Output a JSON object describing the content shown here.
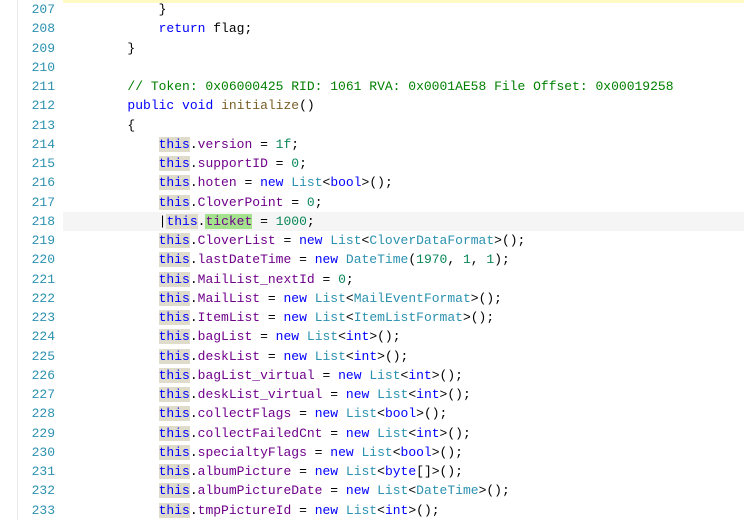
{
  "lines": [
    {
      "n": 207,
      "cls": "hl-yellow-top",
      "tokens": [
        [
          "            ",
          "ws"
        ],
        [
          "}",
          "punc"
        ]
      ]
    },
    {
      "n": 208,
      "tokens": [
        [
          "            ",
          "ws"
        ],
        [
          "return",
          "keyword"
        ],
        [
          " ",
          "ws"
        ],
        [
          "flag",
          "ident"
        ],
        [
          ";",
          "punc"
        ]
      ]
    },
    {
      "n": 209,
      "tokens": [
        [
          "        ",
          "ws"
        ],
        [
          "}",
          "punc"
        ]
      ]
    },
    {
      "n": 210,
      "tokens": [
        [
          "",
          "ws"
        ]
      ]
    },
    {
      "n": 211,
      "tokens": [
        [
          "        ",
          "ws"
        ],
        [
          "// Token: 0x06000425 RID: 1061 RVA: 0x0001AE58 File Offset: 0x00019258",
          "comment"
        ]
      ]
    },
    {
      "n": 212,
      "tokens": [
        [
          "        ",
          "ws"
        ],
        [
          "public",
          "keyword"
        ],
        [
          " ",
          "ws"
        ],
        [
          "void",
          "keyword"
        ],
        [
          " ",
          "ws"
        ],
        [
          "initialize",
          "method"
        ],
        [
          "()",
          "punc"
        ]
      ]
    },
    {
      "n": 213,
      "tokens": [
        [
          "        ",
          "ws"
        ],
        [
          "{",
          "punc"
        ]
      ]
    },
    {
      "n": 214,
      "tokens": [
        [
          "            ",
          "ws"
        ],
        [
          "this",
          "this"
        ],
        [
          ".",
          "punc"
        ],
        [
          "version",
          "prop"
        ],
        [
          " = ",
          "op"
        ],
        [
          "1f",
          "number"
        ],
        [
          ";",
          "punc"
        ]
      ]
    },
    {
      "n": 215,
      "tokens": [
        [
          "            ",
          "ws"
        ],
        [
          "this",
          "this"
        ],
        [
          ".",
          "punc"
        ],
        [
          "supportID",
          "prop"
        ],
        [
          " = ",
          "op"
        ],
        [
          "0",
          "number"
        ],
        [
          ";",
          "punc"
        ]
      ]
    },
    {
      "n": 216,
      "tokens": [
        [
          "            ",
          "ws"
        ],
        [
          "this",
          "this"
        ],
        [
          ".",
          "punc"
        ],
        [
          "hoten",
          "prop"
        ],
        [
          " = ",
          "op"
        ],
        [
          "new",
          "keyword"
        ],
        [
          " ",
          "ws"
        ],
        [
          "List",
          "type"
        ],
        [
          "<",
          "punc"
        ],
        [
          "bool",
          "keyword"
        ],
        [
          ">();",
          "punc"
        ]
      ]
    },
    {
      "n": 217,
      "tokens": [
        [
          "            ",
          "ws"
        ],
        [
          "this",
          "this"
        ],
        [
          ".",
          "punc"
        ],
        [
          "CloverPoint",
          "prop"
        ],
        [
          " = ",
          "op"
        ],
        [
          "0",
          "number"
        ],
        [
          ";",
          "punc"
        ]
      ]
    },
    {
      "n": 218,
      "cls": "current",
      "tokens": [
        [
          "            ",
          "ws"
        ],
        [
          "|",
          "caret"
        ],
        [
          "this",
          "this"
        ],
        [
          ".",
          "punc"
        ],
        [
          "ticket",
          "ticket"
        ],
        [
          " = ",
          "op"
        ],
        [
          "1000",
          "number"
        ],
        [
          ";",
          "punc"
        ]
      ]
    },
    {
      "n": 219,
      "tokens": [
        [
          "            ",
          "ws"
        ],
        [
          "this",
          "this"
        ],
        [
          ".",
          "punc"
        ],
        [
          "CloverList",
          "prop"
        ],
        [
          " = ",
          "op"
        ],
        [
          "new",
          "keyword"
        ],
        [
          " ",
          "ws"
        ],
        [
          "List",
          "type"
        ],
        [
          "<",
          "punc"
        ],
        [
          "CloverDataFormat",
          "type"
        ],
        [
          ">();",
          "punc"
        ]
      ]
    },
    {
      "n": 220,
      "tokens": [
        [
          "            ",
          "ws"
        ],
        [
          "this",
          "this"
        ],
        [
          ".",
          "punc"
        ],
        [
          "lastDateTime",
          "prop"
        ],
        [
          " = ",
          "op"
        ],
        [
          "new",
          "keyword"
        ],
        [
          " ",
          "ws"
        ],
        [
          "DateTime",
          "type"
        ],
        [
          "(",
          "punc"
        ],
        [
          "1970",
          "number"
        ],
        [
          ", ",
          "punc"
        ],
        [
          "1",
          "number"
        ],
        [
          ", ",
          "punc"
        ],
        [
          "1",
          "number"
        ],
        [
          ");",
          "punc"
        ]
      ]
    },
    {
      "n": 221,
      "tokens": [
        [
          "            ",
          "ws"
        ],
        [
          "this",
          "this"
        ],
        [
          ".",
          "punc"
        ],
        [
          "MailList_nextId",
          "prop"
        ],
        [
          " = ",
          "op"
        ],
        [
          "0",
          "number"
        ],
        [
          ";",
          "punc"
        ]
      ]
    },
    {
      "n": 222,
      "tokens": [
        [
          "            ",
          "ws"
        ],
        [
          "this",
          "this"
        ],
        [
          ".",
          "punc"
        ],
        [
          "MailList",
          "prop"
        ],
        [
          " = ",
          "op"
        ],
        [
          "new",
          "keyword"
        ],
        [
          " ",
          "ws"
        ],
        [
          "List",
          "type"
        ],
        [
          "<",
          "punc"
        ],
        [
          "MailEventFormat",
          "type"
        ],
        [
          ">();",
          "punc"
        ]
      ]
    },
    {
      "n": 223,
      "tokens": [
        [
          "            ",
          "ws"
        ],
        [
          "this",
          "this"
        ],
        [
          ".",
          "punc"
        ],
        [
          "ItemList",
          "prop"
        ],
        [
          " = ",
          "op"
        ],
        [
          "new",
          "keyword"
        ],
        [
          " ",
          "ws"
        ],
        [
          "List",
          "type"
        ],
        [
          "<",
          "punc"
        ],
        [
          "ItemListFormat",
          "type"
        ],
        [
          ">();",
          "punc"
        ]
      ]
    },
    {
      "n": 224,
      "tokens": [
        [
          "            ",
          "ws"
        ],
        [
          "this",
          "this"
        ],
        [
          ".",
          "punc"
        ],
        [
          "bagList",
          "prop"
        ],
        [
          " = ",
          "op"
        ],
        [
          "new",
          "keyword"
        ],
        [
          " ",
          "ws"
        ],
        [
          "List",
          "type"
        ],
        [
          "<",
          "punc"
        ],
        [
          "int",
          "keyword"
        ],
        [
          ">();",
          "punc"
        ]
      ]
    },
    {
      "n": 225,
      "tokens": [
        [
          "            ",
          "ws"
        ],
        [
          "this",
          "this"
        ],
        [
          ".",
          "punc"
        ],
        [
          "deskList",
          "prop"
        ],
        [
          " = ",
          "op"
        ],
        [
          "new",
          "keyword"
        ],
        [
          " ",
          "ws"
        ],
        [
          "List",
          "type"
        ],
        [
          "<",
          "punc"
        ],
        [
          "int",
          "keyword"
        ],
        [
          ">();",
          "punc"
        ]
      ]
    },
    {
      "n": 226,
      "tokens": [
        [
          "            ",
          "ws"
        ],
        [
          "this",
          "this"
        ],
        [
          ".",
          "punc"
        ],
        [
          "bagList_virtual",
          "prop"
        ],
        [
          " = ",
          "op"
        ],
        [
          "new",
          "keyword"
        ],
        [
          " ",
          "ws"
        ],
        [
          "List",
          "type"
        ],
        [
          "<",
          "punc"
        ],
        [
          "int",
          "keyword"
        ],
        [
          ">();",
          "punc"
        ]
      ]
    },
    {
      "n": 227,
      "tokens": [
        [
          "            ",
          "ws"
        ],
        [
          "this",
          "this"
        ],
        [
          ".",
          "punc"
        ],
        [
          "deskList_virtual",
          "prop"
        ],
        [
          " = ",
          "op"
        ],
        [
          "new",
          "keyword"
        ],
        [
          " ",
          "ws"
        ],
        [
          "List",
          "type"
        ],
        [
          "<",
          "punc"
        ],
        [
          "int",
          "keyword"
        ],
        [
          ">();",
          "punc"
        ]
      ]
    },
    {
      "n": 228,
      "tokens": [
        [
          "            ",
          "ws"
        ],
        [
          "this",
          "this"
        ],
        [
          ".",
          "punc"
        ],
        [
          "collectFlags",
          "prop"
        ],
        [
          " = ",
          "op"
        ],
        [
          "new",
          "keyword"
        ],
        [
          " ",
          "ws"
        ],
        [
          "List",
          "type"
        ],
        [
          "<",
          "punc"
        ],
        [
          "bool",
          "keyword"
        ],
        [
          ">();",
          "punc"
        ]
      ]
    },
    {
      "n": 229,
      "tokens": [
        [
          "            ",
          "ws"
        ],
        [
          "this",
          "this"
        ],
        [
          ".",
          "punc"
        ],
        [
          "collectFailedCnt",
          "prop"
        ],
        [
          " = ",
          "op"
        ],
        [
          "new",
          "keyword"
        ],
        [
          " ",
          "ws"
        ],
        [
          "List",
          "type"
        ],
        [
          "<",
          "punc"
        ],
        [
          "int",
          "keyword"
        ],
        [
          ">();",
          "punc"
        ]
      ]
    },
    {
      "n": 230,
      "tokens": [
        [
          "            ",
          "ws"
        ],
        [
          "this",
          "this"
        ],
        [
          ".",
          "punc"
        ],
        [
          "specialtyFlags",
          "prop"
        ],
        [
          " = ",
          "op"
        ],
        [
          "new",
          "keyword"
        ],
        [
          " ",
          "ws"
        ],
        [
          "List",
          "type"
        ],
        [
          "<",
          "punc"
        ],
        [
          "bool",
          "keyword"
        ],
        [
          ">();",
          "punc"
        ]
      ]
    },
    {
      "n": 231,
      "tokens": [
        [
          "            ",
          "ws"
        ],
        [
          "this",
          "this"
        ],
        [
          ".",
          "punc"
        ],
        [
          "albumPicture",
          "prop"
        ],
        [
          " = ",
          "op"
        ],
        [
          "new",
          "keyword"
        ],
        [
          " ",
          "ws"
        ],
        [
          "List",
          "type"
        ],
        [
          "<",
          "punc"
        ],
        [
          "byte",
          "keyword"
        ],
        [
          "[]>();",
          "punc"
        ]
      ]
    },
    {
      "n": 232,
      "tokens": [
        [
          "            ",
          "ws"
        ],
        [
          "this",
          "this"
        ],
        [
          ".",
          "punc"
        ],
        [
          "albumPictureDate",
          "prop"
        ],
        [
          " = ",
          "op"
        ],
        [
          "new",
          "keyword"
        ],
        [
          " ",
          "ws"
        ],
        [
          "List",
          "type"
        ],
        [
          "<",
          "punc"
        ],
        [
          "DateTime",
          "type"
        ],
        [
          ">();",
          "punc"
        ]
      ]
    },
    {
      "n": 233,
      "tokens": [
        [
          "            ",
          "ws"
        ],
        [
          "this",
          "this"
        ],
        [
          ".",
          "punc"
        ],
        [
          "tmpPictureId",
          "prop"
        ],
        [
          " = ",
          "op"
        ],
        [
          "new",
          "keyword"
        ],
        [
          " ",
          "ws"
        ],
        [
          "List",
          "type"
        ],
        [
          "<",
          "punc"
        ],
        [
          "int",
          "keyword"
        ],
        [
          ">();",
          "punc"
        ]
      ]
    }
  ]
}
